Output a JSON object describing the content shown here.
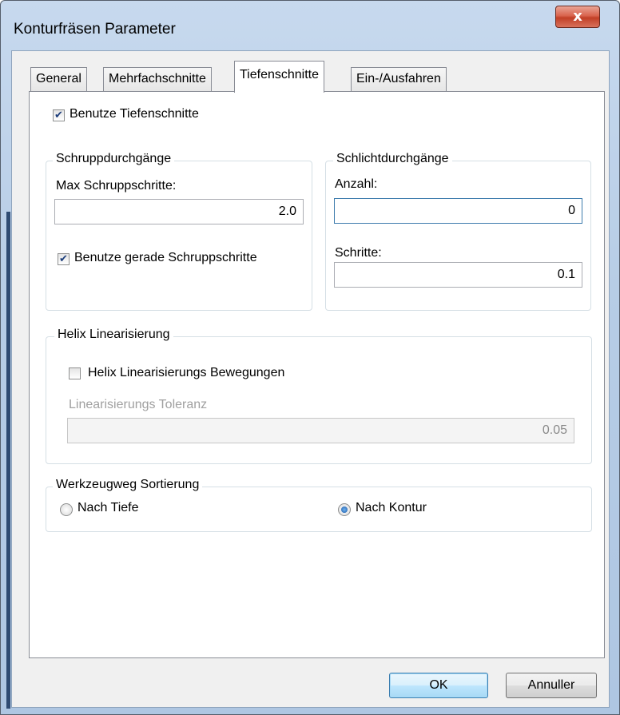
{
  "window": {
    "title": "Konturfräsen Parameter",
    "close_glyph": "x"
  },
  "tabs": [
    {
      "label": "General"
    },
    {
      "label": "Mehrfachschnitte"
    },
    {
      "label": "Tiefenschnitte",
      "active": true
    },
    {
      "label": "Ein-/Ausfahren"
    }
  ],
  "depth_cuts": {
    "use_depth_cuts_label": "Benutze Tiefenschnitte",
    "use_depth_cuts_checked": true
  },
  "rough_passes": {
    "title": "Schruppdurchgänge",
    "max_steps_label": "Max Schruppschritte:",
    "max_steps_value": "2.0",
    "even_steps_label": "Benutze gerade Schruppschritte",
    "even_steps_checked": true
  },
  "finish_passes": {
    "title": "Schlichtdurchgänge",
    "count_label": "Anzahl:",
    "count_value": "0",
    "steps_label": "Schritte:",
    "steps_value": "0.1"
  },
  "helix": {
    "title": "Helix Linearisierung",
    "moves_label": "Helix Linearisierungs Bewegungen",
    "moves_checked": false,
    "tolerance_label": "Linearisierungs Toleranz",
    "tolerance_value": "0.05"
  },
  "toolpath_sort": {
    "title": "Werkzeugweg Sortierung",
    "by_depth_label": "Nach Tiefe",
    "by_contour_label": "Nach Kontur",
    "selected": "Nach Kontur"
  },
  "buttons": {
    "ok_label": "OK",
    "cancel_label": "Annuller"
  },
  "colors": {
    "title_bar": "#b7cde6",
    "close_button": "#c94a32",
    "accent_blue": "#3c7fb1"
  }
}
